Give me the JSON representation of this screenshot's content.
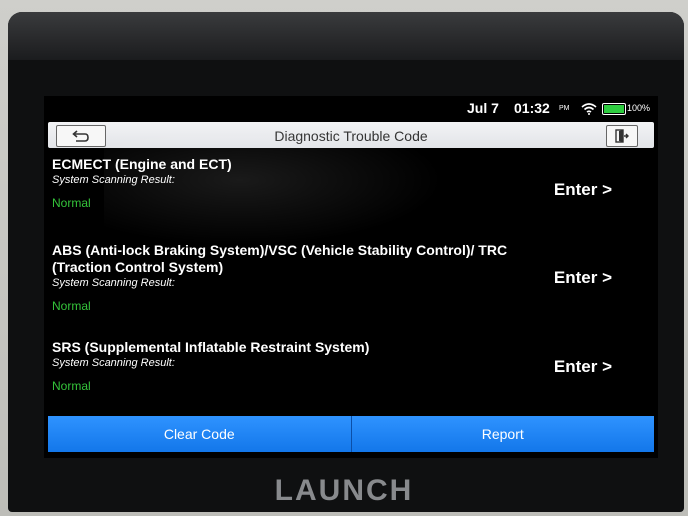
{
  "status_bar": {
    "date": "Jul 7",
    "time": "01:32",
    "ampm": "PM",
    "battery": "100%"
  },
  "header": {
    "title": "Diagnostic Trouble Code"
  },
  "systems": [
    {
      "name": "ECMECT (Engine and ECT)",
      "result_label": "System Scanning Result:",
      "status": "Normal",
      "action": "Enter >"
    },
    {
      "name": "ABS (Anti-lock Braking System)/VSC (Vehicle Stability Control)/ TRC (Traction Control System)",
      "result_label": "System Scanning Result:",
      "status": "Normal",
      "action": "Enter >"
    },
    {
      "name": "SRS (Supplemental Inflatable Restraint System)",
      "result_label": "System Scanning Result:",
      "status": "Normal",
      "action": "Enter >"
    }
  ],
  "footer": {
    "clear_code": "Clear Code",
    "report": "Report"
  },
  "device": {
    "brand": "LAUNCH"
  },
  "colors": {
    "accent_blue": "#1f84f5",
    "status_green": "#34c33a",
    "screen_bg": "#000000"
  }
}
